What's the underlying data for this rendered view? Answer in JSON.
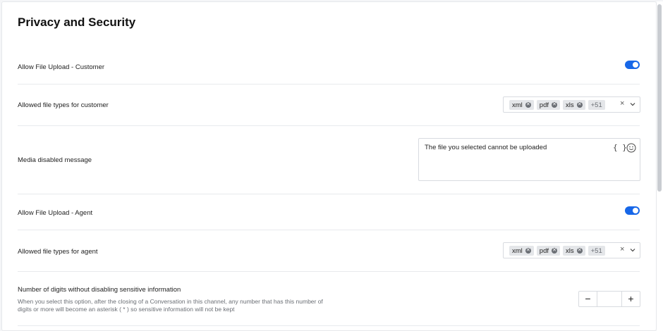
{
  "page": {
    "title": "Privacy and Security"
  },
  "file_upload_customer": {
    "label": "Allow File Upload - Customer",
    "enabled": true
  },
  "file_types_customer": {
    "label": "Allowed file types for customer",
    "chips": [
      "xml",
      "pdf",
      "xls"
    ],
    "more": "+51",
    "clear": "×"
  },
  "media_disabled": {
    "label": "Media disabled message",
    "value": "The file you selected cannot be uploaded",
    "variables_button": "{ }"
  },
  "file_upload_agent": {
    "label": "Allow File Upload - Agent",
    "enabled": true
  },
  "file_types_agent": {
    "label": "Allowed file types for agent",
    "chips": [
      "xml",
      "pdf",
      "xls"
    ],
    "more": "+51",
    "clear": "×"
  },
  "sensitive_digits": {
    "label": "Number of digits without disabling sensitive information",
    "help": "When you select this option, after the closing of a Conversation in this channel, any number that has this number of digits or more will become an asterisk ( * ) so sensitive information will not be kept",
    "value": "",
    "minus": "−",
    "plus": "+"
  },
  "colors": {
    "toggle_on": "#1767e8",
    "chip_bg": "#e4e6e9",
    "border": "#d8dbe0"
  },
  "icons": {
    "chip_remove": "x-circle-icon",
    "dropdown": "chevron-down-icon",
    "emoji": "smiley-icon"
  }
}
